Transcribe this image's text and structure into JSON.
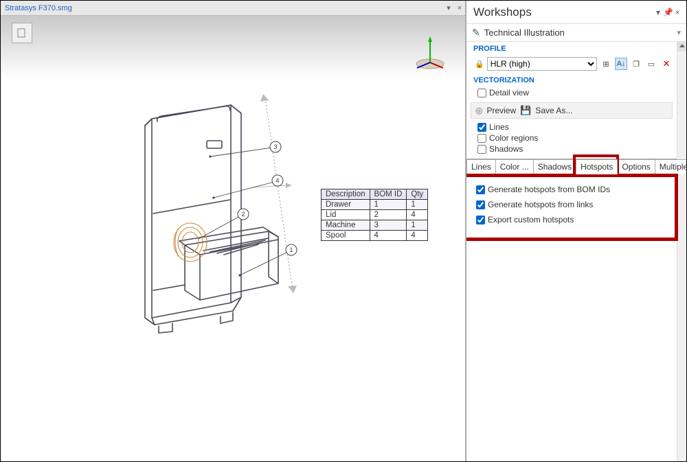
{
  "tab_title": "Stratasys F370.smg",
  "panel": {
    "title": "Workshops",
    "subtitle": "Technical Illustration",
    "profile": {
      "heading": "PROFILE",
      "selected": "HLR (high)"
    },
    "vectorization": {
      "heading": "VECTORIZATION",
      "detail_view": "Detail view",
      "preview": "Preview",
      "save_as": "Save As...",
      "lines": "Lines",
      "color_regions": "Color regions",
      "shadows": "Shadows"
    },
    "tabs": [
      "Lines",
      "Color ...",
      "Shadows",
      "Hotspots",
      "Options",
      "Multiple"
    ],
    "active_tab": 3,
    "hotspots": {
      "bom": "Generate hotspots from BOM IDs",
      "links": "Generate hotspots from links",
      "custom": "Export custom hotspots"
    }
  },
  "bom": {
    "headers": [
      "Description",
      "BOM ID",
      "Qty"
    ],
    "rows": [
      [
        "Drawer",
        "1",
        "1"
      ],
      [
        "Lid",
        "2",
        "4"
      ],
      [
        "Machine",
        "3",
        "1"
      ],
      [
        "Spool",
        "4",
        "4"
      ]
    ]
  },
  "callouts": [
    "3",
    "4",
    "2",
    "1"
  ]
}
